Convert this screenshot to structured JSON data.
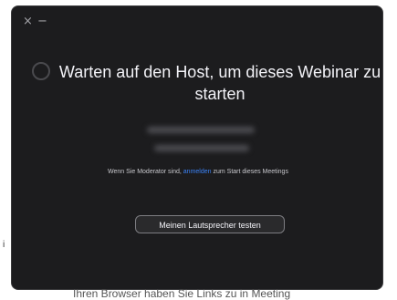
{
  "window": {
    "close_glyph": "×",
    "minimize_glyph": "−"
  },
  "waiting": {
    "title": "Warten auf den Host, um dieses Webinar zu starten"
  },
  "notice": {
    "prefix": "Wenn Sie Moderator sind, ",
    "link": "anmelden",
    "suffix": " zum Start dieses Meetings"
  },
  "actions": {
    "test_speaker": "Meinen Lautsprecher testen"
  },
  "background": {
    "edge_letter": "i",
    "bottom_text": "Ihren Browser haben Sie Links zu in Meeting"
  },
  "colors": {
    "window_bg": "#1c1c1e",
    "link": "#3b82f6"
  },
  "icons": [
    "close-icon",
    "minimize-icon",
    "loading-spinner-icon"
  ]
}
